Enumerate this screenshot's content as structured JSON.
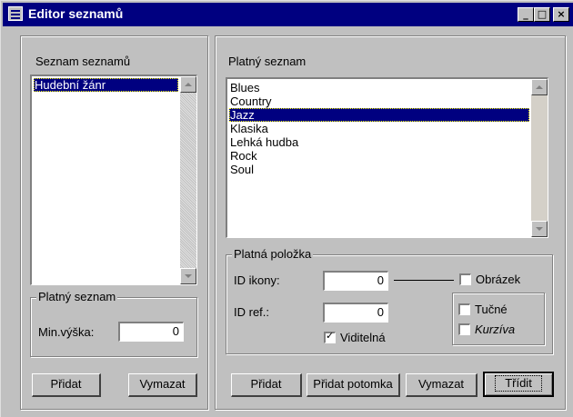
{
  "window": {
    "title": "Editor seznamů",
    "minimize": "_",
    "maximize": "□",
    "close": "×"
  },
  "left": {
    "list_label": "Seznam seznamů",
    "list_items": [
      "Hudební žánr"
    ],
    "group_title": "Platný seznam",
    "min_height_label": "Min.výška:",
    "min_height_value": "0",
    "add_button": "Přidat",
    "delete_button": "Vymazat"
  },
  "right": {
    "list_label": "Platný seznam",
    "list_items": [
      "Blues",
      "Country",
      "Jazz",
      "Klasika",
      "Lehká hudba",
      "Rock",
      "Soul"
    ],
    "selected_index": 2,
    "group_title": "Platná položka",
    "icon_id_label": "ID ikony:",
    "icon_id_value": "0",
    "picture_label": "Obrázek",
    "ref_id_label": "ID ref.:",
    "ref_id_value": "0",
    "bold_label": "Tučné",
    "italic_label": "Kurzíva",
    "visible_label": "Viditelná",
    "visible_checked": true,
    "add_button": "Přidat",
    "add_child_button": "Přidat potomka",
    "delete_button": "Vymazat",
    "sort_button": "Třídit"
  }
}
